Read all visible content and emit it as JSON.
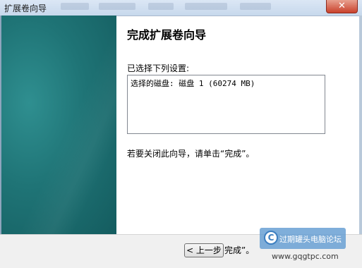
{
  "window": {
    "title": "扩展卷向导",
    "close_glyph": "✕"
  },
  "wizard": {
    "heading": "完成扩展卷向导",
    "settings_label": "已选择下列设置:",
    "settings_lines": [
      "选择的磁盘: 磁盘 1 (60274 MB)"
    ],
    "finish_hint": "若要关闭此向导，请单击“完成”。"
  },
  "buttons": {
    "back_label": "< 上一步",
    "finish_fragment": "完成”。"
  },
  "watermark": {
    "logo_glyph": "C",
    "site_name": "过期罐头电脑论坛",
    "url": "www.gqgtpc.com"
  },
  "colors": {
    "side_panel": "#1f7476",
    "titlebar": "#c7d8ec",
    "close_button": "#c9412b",
    "watermark": "#68a0d4"
  },
  "icons": [
    "close-icon",
    "watermark-logo-icon"
  ]
}
